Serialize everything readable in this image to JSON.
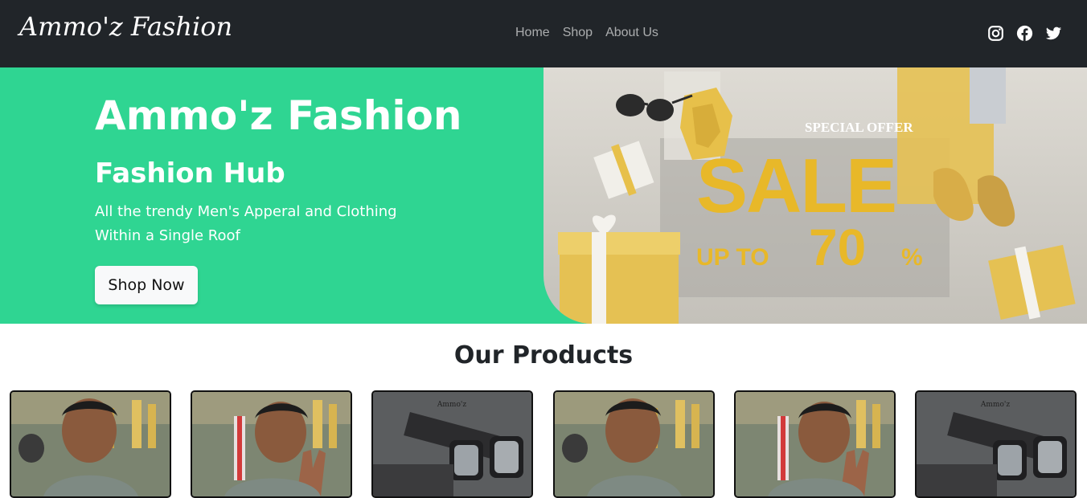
{
  "navbar": {
    "brand": "Ammo'z Fashion",
    "links": [
      "Home",
      "Shop",
      "About Us"
    ],
    "social_icons": [
      "instagram-icon",
      "facebook-icon",
      "twitter-icon"
    ]
  },
  "hero": {
    "title": "Ammo'z Fashion",
    "subtitle": "Fashion Hub",
    "description": "All the trendy Men's Apperal and Clothing Within a Single Roof",
    "button_label": "Shop Now",
    "banner": {
      "tag": "SPECIAL OFFER",
      "headline": "SALE",
      "offer_prefix": "UP TO",
      "offer_value": "70",
      "offer_suffix": "%"
    },
    "bg_color": "#2fd592"
  },
  "products": {
    "title": "Our Products",
    "cards": [
      {
        "image": "person-smiling-photo"
      },
      {
        "image": "person-holding-pen-photo"
      },
      {
        "image": "watches-photo",
        "overlay_text": "Ammo'z"
      },
      {
        "image": "person-smiling-photo"
      },
      {
        "image": "person-holding-pen-photo"
      },
      {
        "image": "watches-photo",
        "overlay_text": "Ammo'z"
      }
    ]
  },
  "colors": {
    "navbar": "#212529",
    "accent": "#2fd592",
    "sale": "#e8b829"
  }
}
